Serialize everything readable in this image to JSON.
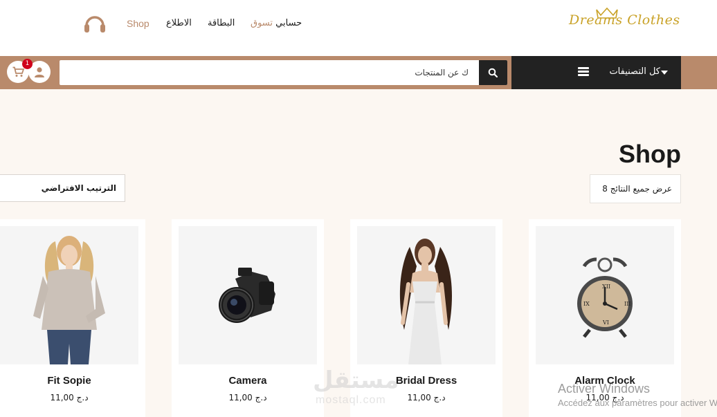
{
  "brand": {
    "logo_text": "Dreams Clothes"
  },
  "topnav": {
    "account": "حسابي",
    "shop_ar": "تسوق",
    "card": "البطاقة",
    "about": "الاطلاع",
    "shop": "Shop"
  },
  "bar": {
    "categories_label": "كل التصنيفات",
    "search_placeholder": "ك عن المنتجات",
    "cart_count": "1"
  },
  "page": {
    "title": "Shop",
    "results_text": "عرض جميع النتائج 8",
    "sort_label": "الترتيب الافتراضي"
  },
  "products": [
    {
      "name": "Alarm Clock",
      "price": "د.ج 11,00",
      "icon": "alarm-clock"
    },
    {
      "name": "Bridal Dress",
      "price": "د.ج 11,00",
      "icon": "bridal-dress"
    },
    {
      "name": "Camera",
      "price": "د.ج 11,00",
      "icon": "camera"
    },
    {
      "name": "Fit Sopie",
      "price": "د.ج 11,00",
      "icon": "sweater-model"
    }
  ],
  "watermark": {
    "arabic": "مستقل",
    "latin": "mostaql.com"
  },
  "os_overlay": {
    "line1": "Activer Windows",
    "line2": "Accédez aux paramètres pour activer Windows."
  },
  "colors": {
    "accent": "#b98a6b",
    "dark": "#222222",
    "badge": "#d0021b",
    "background": "#fcf7f2",
    "logo": "#c9a227"
  }
}
